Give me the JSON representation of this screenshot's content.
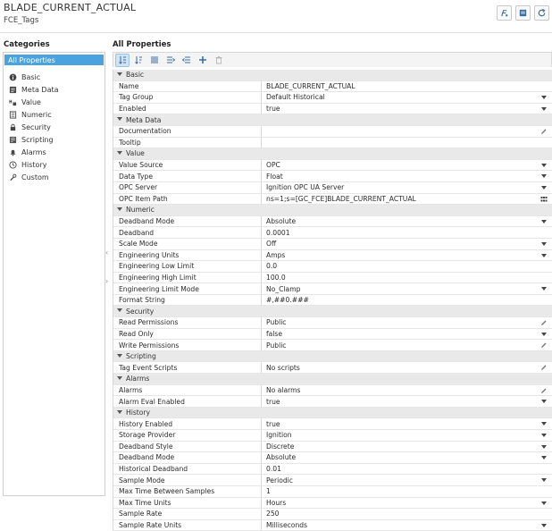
{
  "header": {
    "title": "BLADE_CURRENT_ACTUAL",
    "subtitle": "FCE_Tags",
    "buttons": [
      "function-icon",
      "notes-icon",
      "refresh-icon"
    ]
  },
  "categories": {
    "title": "Categories",
    "items": [
      {
        "label": "All Properties",
        "icon": "",
        "selected": true
      },
      {
        "label": "Basic",
        "icon": "info-icon"
      },
      {
        "label": "Meta Data",
        "icon": "meta-data-icon"
      },
      {
        "label": "Value",
        "icon": "value-icon"
      },
      {
        "label": "Numeric",
        "icon": "numeric-icon"
      },
      {
        "label": "Security",
        "icon": "lock-icon"
      },
      {
        "label": "Scripting",
        "icon": "script-icon"
      },
      {
        "label": "Alarms",
        "icon": "bell-icon"
      },
      {
        "label": "History",
        "icon": "clock-icon"
      },
      {
        "label": "Custom",
        "icon": "wrench-icon"
      }
    ]
  },
  "properties": {
    "title": "All Properties",
    "toolbar": [
      "sort-category-icon",
      "sort-alpha-icon",
      "list-view-icon",
      "expand-icon",
      "collapse-icon",
      "add-icon",
      "delete-icon"
    ],
    "sections": [
      {
        "name": "Basic",
        "rows": [
          {
            "name": "Name",
            "value": "BLADE_CURRENT_ACTUAL",
            "control": ""
          },
          {
            "name": "Tag Group",
            "value": "Default Historical",
            "control": "dropdown"
          },
          {
            "name": "Enabled",
            "value": "true",
            "control": "dropdown"
          }
        ]
      },
      {
        "name": "Meta Data",
        "rows": [
          {
            "name": "Documentation",
            "value": "",
            "control": "edit"
          },
          {
            "name": "Tooltip",
            "value": "",
            "control": ""
          }
        ]
      },
      {
        "name": "Value",
        "rows": [
          {
            "name": "Value Source",
            "value": "OPC",
            "control": "dropdown"
          },
          {
            "name": "Data Type",
            "value": "Float",
            "control": "dropdown"
          },
          {
            "name": "OPC Server",
            "value": "Ignition OPC UA Server",
            "control": "dropdown"
          },
          {
            "name": "OPC Item Path",
            "value": "ns=1;s=[GC_FCE]BLADE_CURRENT_ACTUAL",
            "control": "browse"
          }
        ]
      },
      {
        "name": "Numeric",
        "rows": [
          {
            "name": "Deadband Mode",
            "value": "Absolute",
            "control": "dropdown"
          },
          {
            "name": "Deadband",
            "value": "0.0001",
            "control": ""
          },
          {
            "name": "Scale Mode",
            "value": "Off",
            "control": "dropdown"
          },
          {
            "name": "Engineering Units",
            "value": "Amps",
            "control": "dropdown"
          },
          {
            "name": "Engineering Low Limit",
            "value": "0.0",
            "control": ""
          },
          {
            "name": "Engineering High Limit",
            "value": "100.0",
            "control": ""
          },
          {
            "name": "Engineering Limit Mode",
            "value": "No_Clamp",
            "control": "dropdown"
          },
          {
            "name": "Format String",
            "value": "#,##0.###",
            "control": ""
          }
        ]
      },
      {
        "name": "Security",
        "rows": [
          {
            "name": "Read Permissions",
            "value": "Public",
            "control": "edit"
          },
          {
            "name": "Read Only",
            "value": "false",
            "control": "dropdown"
          },
          {
            "name": "Write Permissions",
            "value": "Public",
            "control": "edit"
          }
        ]
      },
      {
        "name": "Scripting",
        "rows": [
          {
            "name": "Tag Event Scripts",
            "value": "No scripts",
            "control": "edit"
          }
        ]
      },
      {
        "name": "Alarms",
        "rows": [
          {
            "name": "Alarms",
            "value": "No alarms",
            "control": "edit"
          },
          {
            "name": "Alarm Eval Enabled",
            "value": "true",
            "control": "dropdown"
          }
        ]
      },
      {
        "name": "History",
        "rows": [
          {
            "name": "History Enabled",
            "value": "true",
            "control": "dropdown"
          },
          {
            "name": "Storage Provider",
            "value": "Ignition",
            "control": "dropdown"
          },
          {
            "name": "Deadband Style",
            "value": "Discrete",
            "control": "dropdown"
          },
          {
            "name": "Deadband Mode",
            "value": "Absolute",
            "control": "dropdown"
          },
          {
            "name": "Historical Deadband",
            "value": "0.01",
            "control": ""
          },
          {
            "name": "Sample Mode",
            "value": "Periodic",
            "control": "dropdown"
          },
          {
            "name": "Max Time Between Samples",
            "value": "1",
            "control": ""
          },
          {
            "name": "Max Time Units",
            "value": "Hours",
            "control": "dropdown"
          },
          {
            "name": "Sample Rate",
            "value": "250",
            "control": ""
          },
          {
            "name": "Sample Rate Units",
            "value": "Milliseconds",
            "control": "dropdown"
          }
        ]
      }
    ]
  }
}
